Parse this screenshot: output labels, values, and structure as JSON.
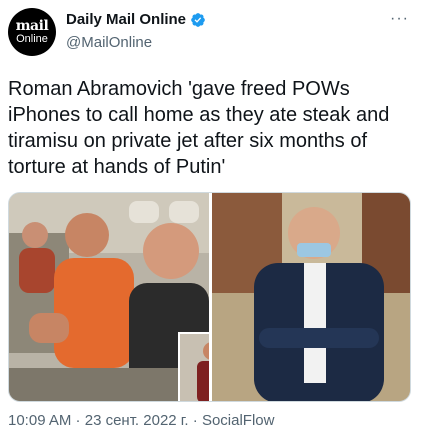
{
  "account": {
    "avatar_line1": "mail",
    "avatar_line2": "Online",
    "display_name": "Daily Mail Online",
    "handle": "@MailOnline"
  },
  "tweet": {
    "text": "Roman Abramovich 'gave freed POWs iPhones to call home as they ate steak and tiramisu on private jet after six months of torture at hands of Putin'",
    "time": "10:09 AM",
    "separator": " · ",
    "date": "23 сент. 2022 г.",
    "source": "SocialFlow"
  },
  "icons": {
    "verified": "verified-badge-icon",
    "more": "more-options-icon"
  },
  "colors": {
    "verified": "#1d9bf0",
    "secondary_text": "#536471",
    "border": "#cfd9de"
  }
}
